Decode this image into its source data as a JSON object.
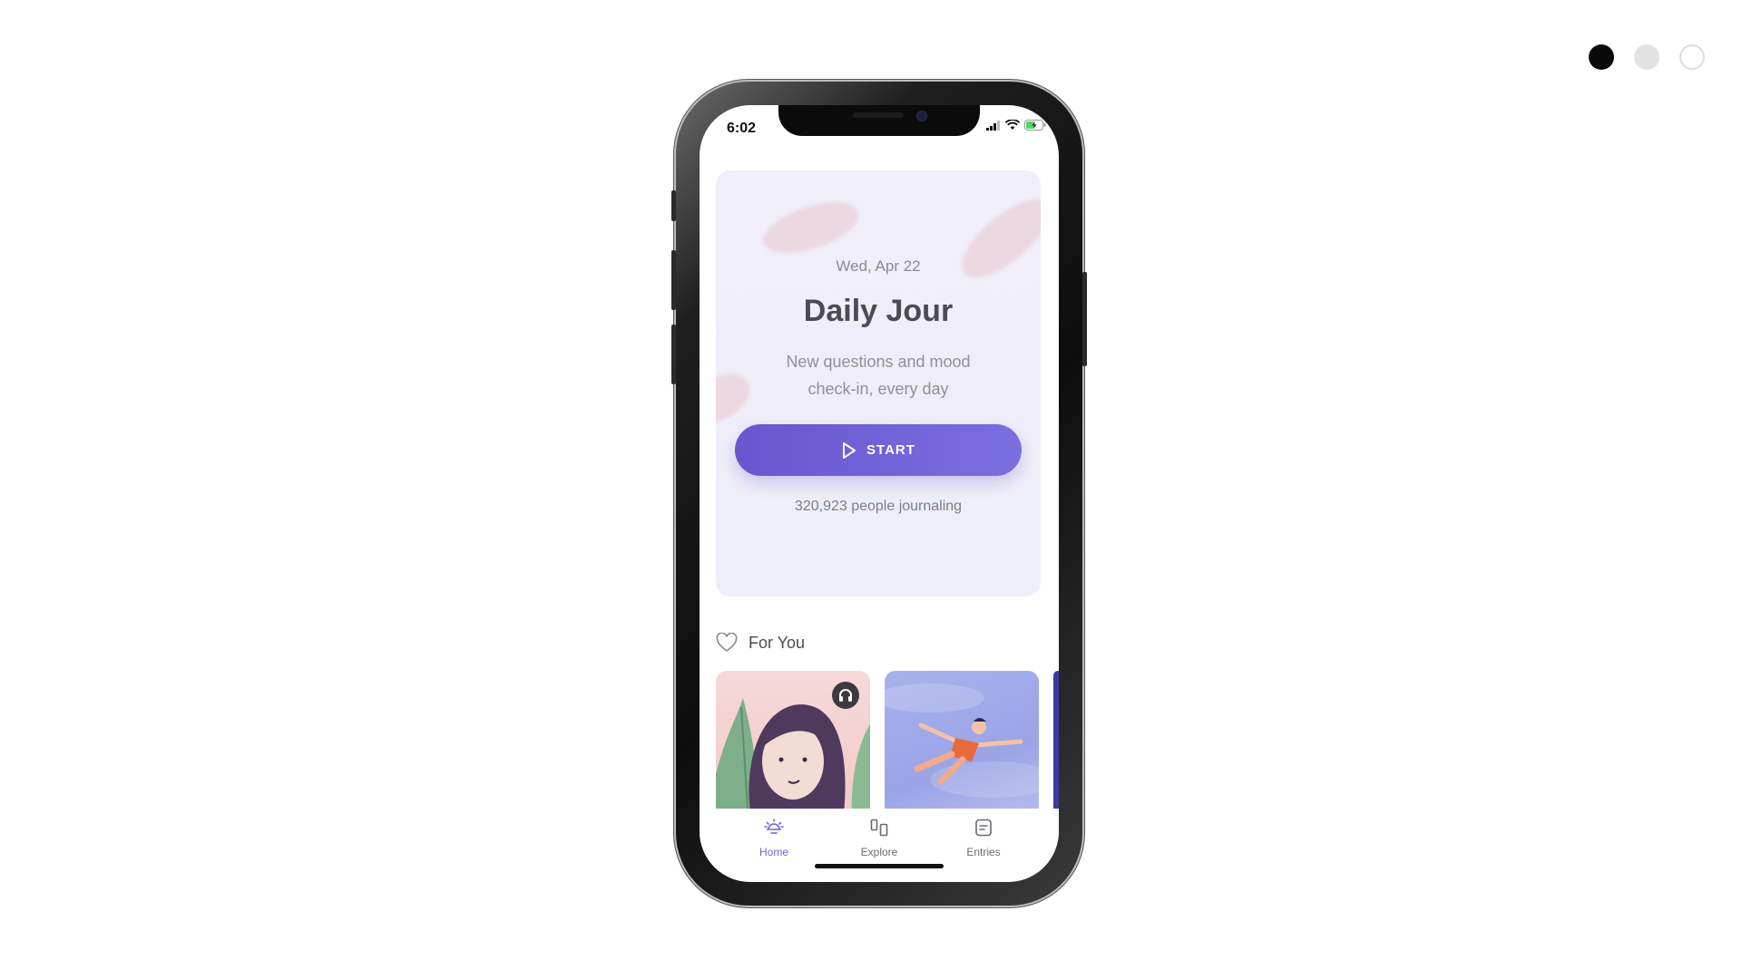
{
  "swatches": {
    "colors": [
      "#0a0a0a",
      "#e2e2e2",
      "#ffffff"
    ],
    "selected_index": 0
  },
  "status_bar": {
    "time": "6:02",
    "icons": [
      "signal-icon",
      "wifi-icon",
      "battery-charging-icon"
    ]
  },
  "daily_card": {
    "date": "Wed, Apr 22",
    "title": "Daily Jour",
    "subtitle": "New questions and mood check-in, every day",
    "start_label": "START",
    "start_icon": "play-icon",
    "count_text": "320,923 people journaling"
  },
  "for_you": {
    "label": "For You",
    "icon": "heart-icon",
    "cards": [
      {
        "illustration": "woman-portrait-illustration",
        "badge_icon": "headphones-icon"
      },
      {
        "illustration": "floating-man-illustration"
      },
      {
        "illustration": "partial-card"
      }
    ]
  },
  "tab_bar": {
    "tabs": [
      {
        "label": "Home",
        "icon": "sun-icon",
        "active": true
      },
      {
        "label": "Explore",
        "icon": "explore-icon",
        "active": false
      },
      {
        "label": "Entries",
        "icon": "entries-icon",
        "active": false
      }
    ]
  },
  "colors": {
    "accent": "#6e62d6",
    "card_bg": "#efeff8"
  }
}
